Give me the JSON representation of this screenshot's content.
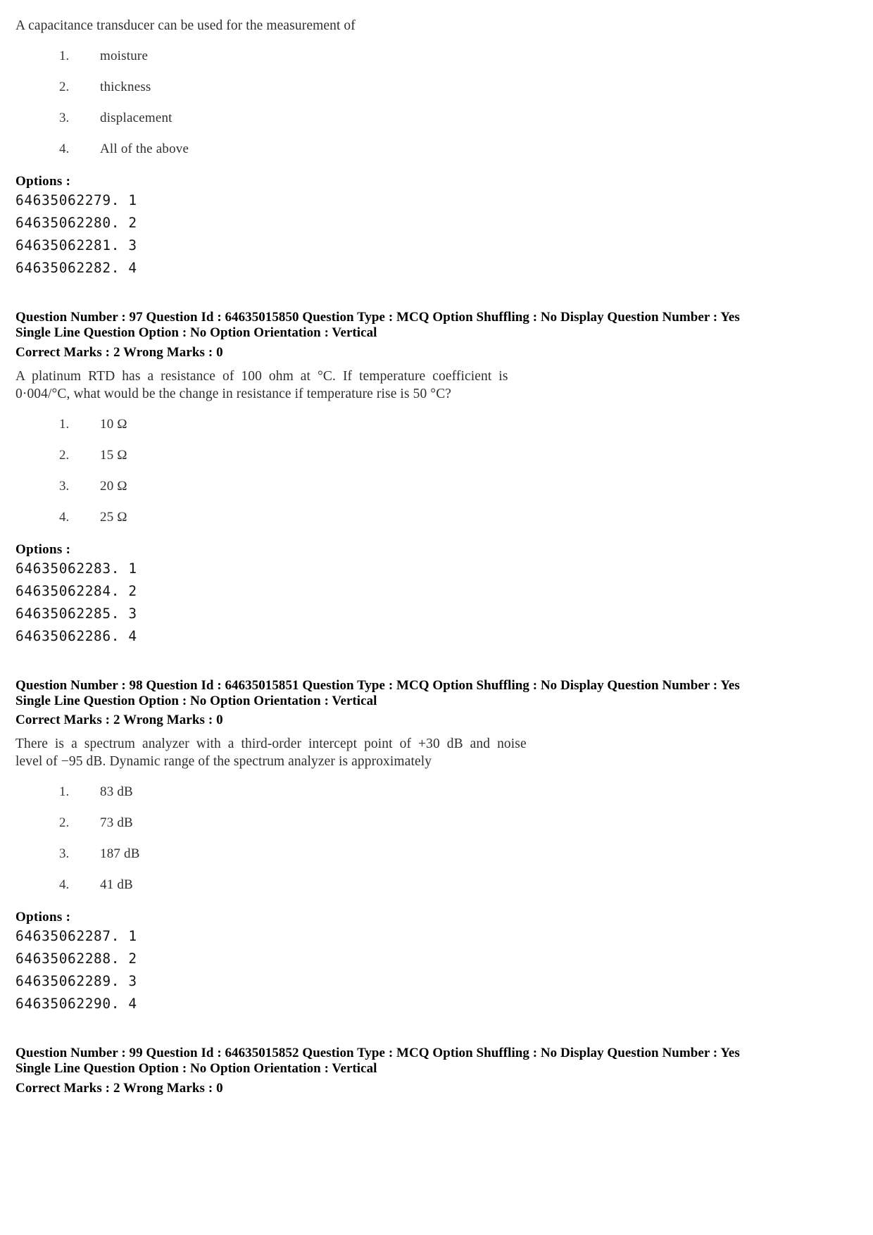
{
  "page": {
    "carryover_question": {
      "stem": "A capacitance transducer can be used for the measurement of",
      "choices": [
        {
          "num": "1.",
          "text": "moisture"
        },
        {
          "num": "2.",
          "text": "thickness"
        },
        {
          "num": "3.",
          "text": "displacement"
        },
        {
          "num": "4.",
          "text": "All of the above"
        }
      ],
      "options_label": "Options :",
      "option_ids": [
        "64635062279. 1",
        "64635062280. 2",
        "64635062281. 3",
        "64635062282. 4"
      ]
    },
    "questions": [
      {
        "meta_line1": "Question Number : 97  Question Id : 64635015850  Question Type : MCQ  Option Shuffling : No  Display Question Number : Yes",
        "meta_line2": "Single Line Question Option : No  Option Orientation : Vertical",
        "marks_line": "Correct Marks : 2  Wrong Marks : 0",
        "stem_lines": [
          "A  platinum  RTD  has  a  resistance  of  100  ohm  at  °C.  If  temperature  coefficient  is",
          "0·004/°C, what would be the change in resistance if temperature rise is 50 °C?"
        ],
        "choices": [
          {
            "num": "1.",
            "text": "10 Ω"
          },
          {
            "num": "2.",
            "text": "15 Ω"
          },
          {
            "num": "3.",
            "text": "20 Ω"
          },
          {
            "num": "4.",
            "text": "25 Ω"
          }
        ],
        "options_label": "Options :",
        "option_ids": [
          "64635062283. 1",
          "64635062284. 2",
          "64635062285. 3",
          "64635062286. 4"
        ]
      },
      {
        "meta_line1": "Question Number : 98  Question Id : 64635015851  Question Type : MCQ  Option Shuffling : No  Display Question Number : Yes",
        "meta_line2": "Single Line Question Option : No  Option Orientation : Vertical",
        "marks_line": "Correct Marks : 2  Wrong Marks : 0",
        "stem_lines": [
          "There  is  a  spectrum  analyzer  with  a  third-order  intercept  point  of  +30  dB  and  noise",
          "level of −95 dB. Dynamic range of the spectrum analyzer is approximately"
        ],
        "choices": [
          {
            "num": "1.",
            "text": "83 dB"
          },
          {
            "num": "2.",
            "text": "73 dB"
          },
          {
            "num": "3.",
            "text": "187 dB"
          },
          {
            "num": "4.",
            "text": "41 dB"
          }
        ],
        "options_label": "Options :",
        "option_ids": [
          "64635062287. 1",
          "64635062288. 2",
          "64635062289. 3",
          "64635062290. 4"
        ]
      },
      {
        "meta_line1": "Question Number : 99  Question Id : 64635015852  Question Type : MCQ  Option Shuffling : No  Display Question Number : Yes",
        "meta_line2": "Single Line Question Option : No  Option Orientation : Vertical",
        "marks_line": "Correct Marks : 2  Wrong Marks : 0",
        "stem_lines": [],
        "choices": [],
        "options_label": "",
        "option_ids": []
      }
    ]
  }
}
